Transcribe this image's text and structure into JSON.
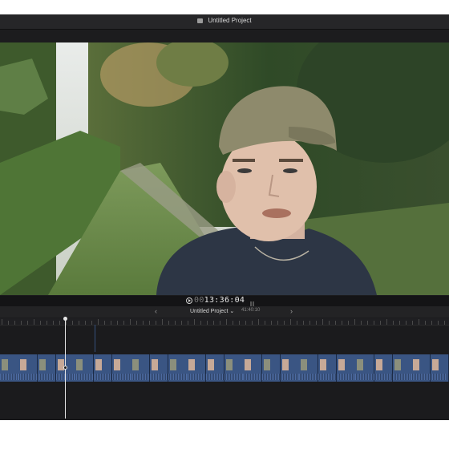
{
  "window": {
    "title": "Untitled Project"
  },
  "transport": {
    "timecode_prefix": "00",
    "timecode": "13:36:04"
  },
  "timeline_header": {
    "prev_label": "‹",
    "project_label": "Untitled Project",
    "dropdown_label": "⌄",
    "duration": "41:40:10",
    "next_label": "›"
  },
  "viewer": {
    "content": "video frame"
  },
  "colors": {
    "clip": "#3a5583",
    "storyline": "#30456a",
    "playhead": "#e6e6e6"
  },
  "clips": [
    {
      "face": false
    },
    {
      "face": true
    },
    {
      "face": false
    },
    {
      "face": true
    },
    {
      "face": false
    },
    {
      "face": true
    },
    {
      "face": true
    },
    {
      "face": false
    },
    {
      "face": true
    },
    {
      "face": false
    },
    {
      "face": true
    },
    {
      "face": true
    },
    {
      "face": false
    },
    {
      "face": true
    },
    {
      "face": false
    },
    {
      "face": true
    },
    {
      "face": false
    },
    {
      "face": true
    },
    {
      "face": true
    },
    {
      "face": false
    },
    {
      "face": true
    },
    {
      "face": false
    },
    {
      "face": true
    },
    {
      "face": true
    }
  ]
}
